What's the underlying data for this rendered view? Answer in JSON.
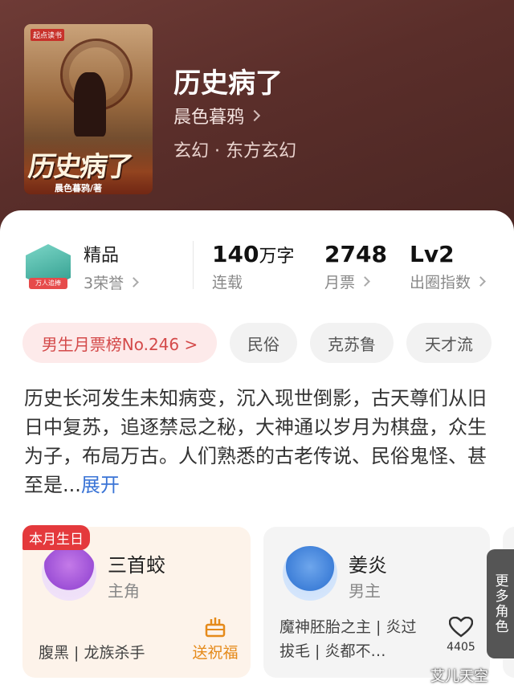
{
  "book": {
    "title": "历史病了",
    "author": "晨色暮鸦",
    "genre": "玄幻 · 东方玄幻",
    "cover_title": "历史病了",
    "cover_author": "晨色暮鸦/著",
    "cover_logo": "起点读书"
  },
  "stats": {
    "quality_label": "精品",
    "honors": "3荣誉",
    "badge_ribbon": "万人追捧",
    "word_count": "140",
    "word_unit": "万字",
    "status": "连载",
    "monthly_votes": "2748",
    "monthly_votes_label": "月票",
    "level": "Lv2",
    "level_label": "出圈指数"
  },
  "tags": [
    "男生月票榜No.246 >",
    "民俗",
    "克苏鲁",
    "天才流"
  ],
  "description": {
    "text": "历史长河发生未知病变，沉入现世倒影，古天尊们从旧日中复苏，追逐禁忌之秘，大神通以岁月为棋盘，众生为子，布局万古。人们熟悉的古老传说、民俗鬼怪、甚至是...",
    "expand": "展开"
  },
  "characters": [
    {
      "birthday_badge": "本月生日",
      "name": "三首蛟",
      "role": "主角",
      "traits": "腹黑 | 龙族杀手",
      "action": "送祝福"
    },
    {
      "name": "姜炎",
      "role": "男主",
      "desc": "魔神胚胎之主 | 炎过拔毛 | 炎都不…",
      "likes": "4405"
    }
  ],
  "more_roles": "更多角色",
  "watermark": "艾儿天空",
  "colors": {
    "hero_bg": "#5a2e2a",
    "rank_tag": "#d44a4a",
    "expand_link": "#3a74d6",
    "birthday": "#e4393c",
    "wish": "#e58a1a"
  }
}
